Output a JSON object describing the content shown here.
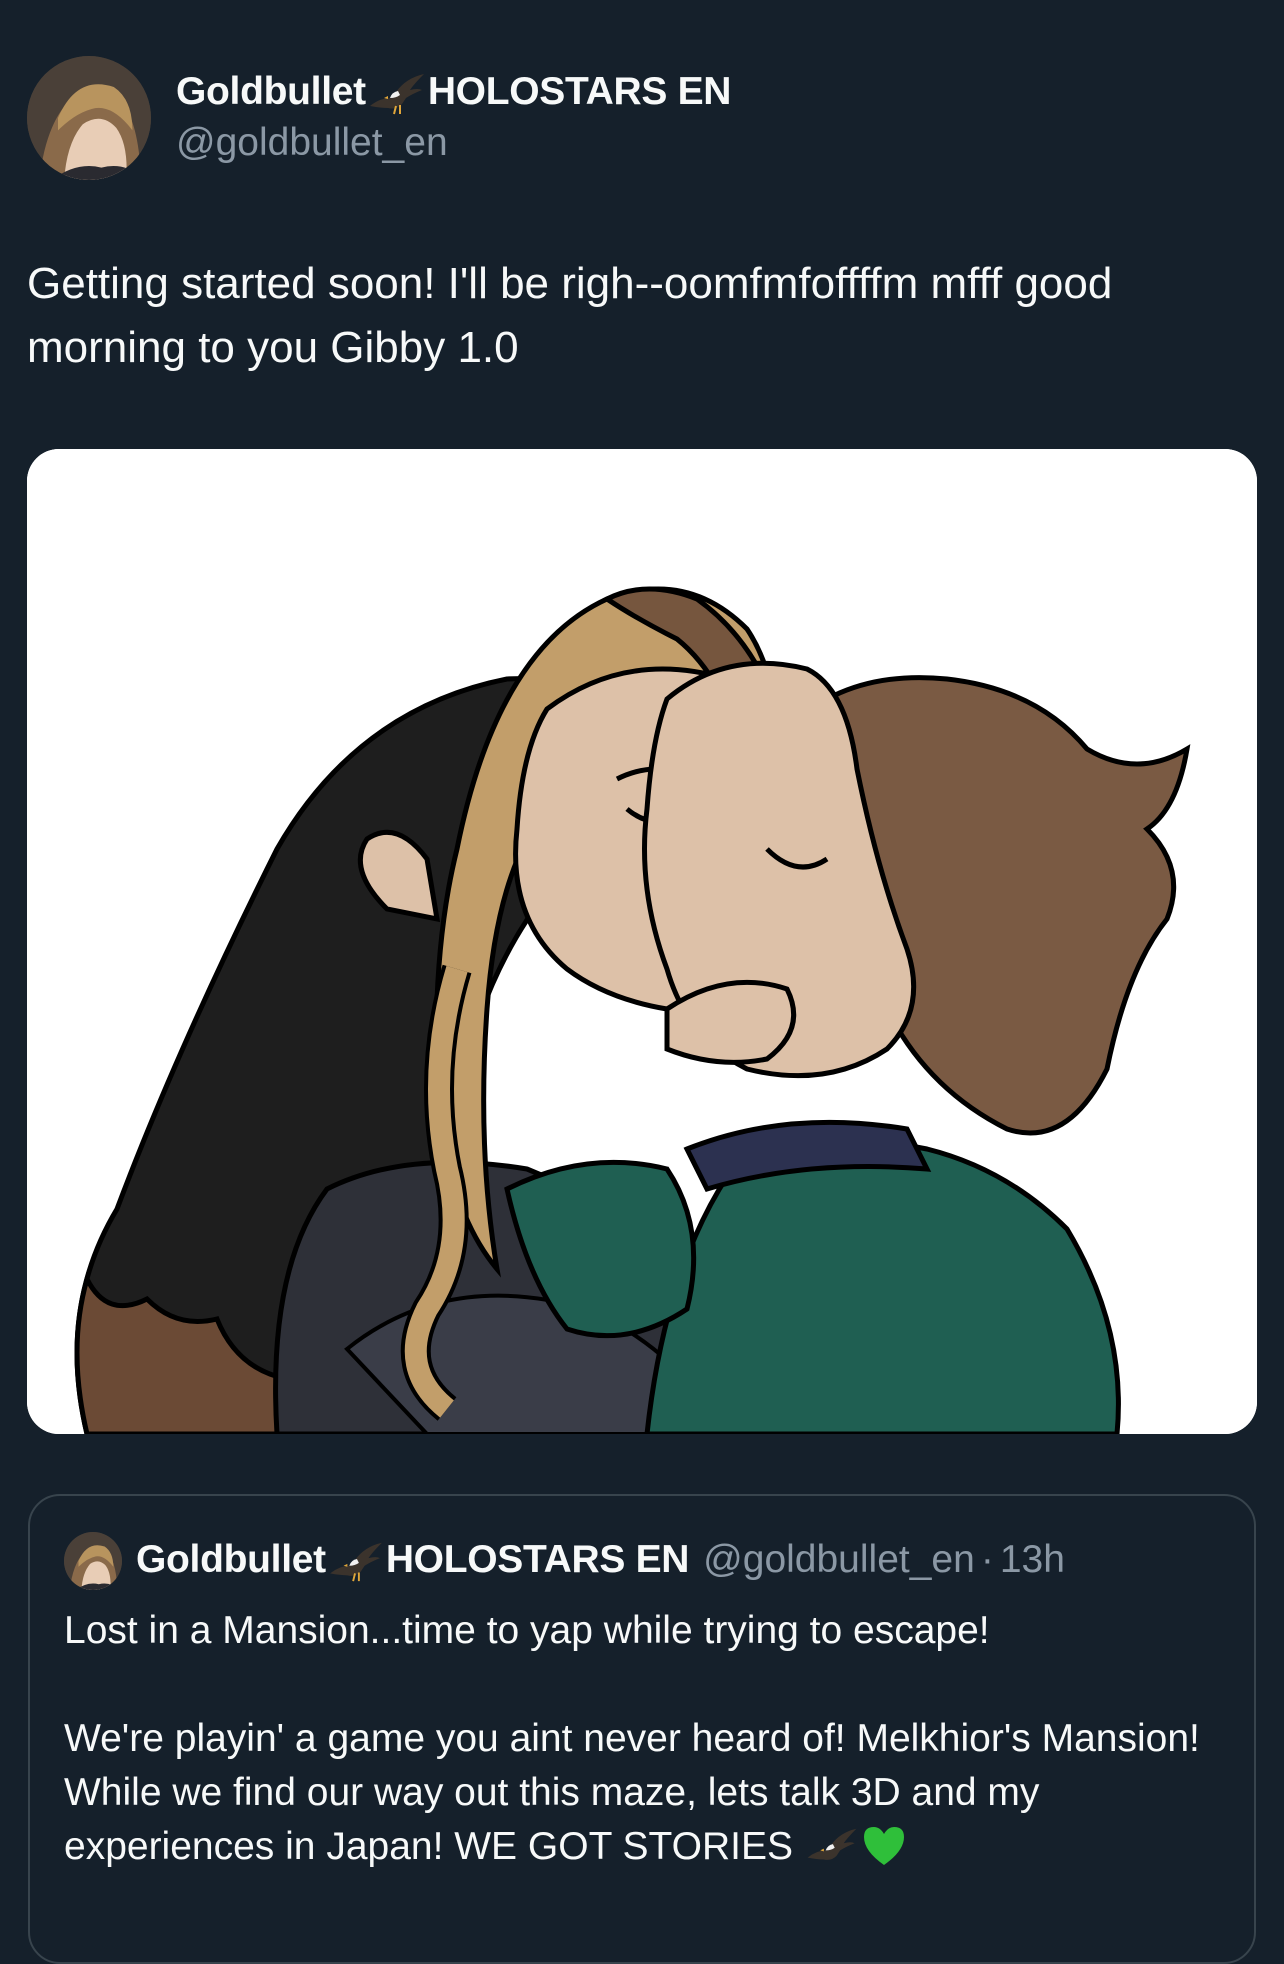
{
  "author": {
    "display_name_prefix": "Goldbullet",
    "display_name_suffix": "HOLOSTARS EN",
    "name_emoji": "eagle-icon",
    "handle": "@goldbullet_en"
  },
  "tweet": {
    "text": "Getting started soon! I'll be righ--oomfmfoffffm mfff good morning to you Gibby 1.0",
    "media": "fan-art-image"
  },
  "quoted_tweet": {
    "display_name_prefix": "Goldbullet",
    "display_name_suffix": "HOLOSTARS EN",
    "handle": "@goldbullet_en",
    "separator": "·",
    "time": "13h",
    "paragraph_1": "Lost in a Mansion...time to yap while trying to escape!",
    "paragraph_2": "We're playin' a game you aint never heard of! Melkhior's Mansion! While we find our way out this maze, lets talk 3D and my experiences in Japan! WE GOT STORIES",
    "trailing_emojis": [
      "eagle-icon",
      "green-heart-icon"
    ]
  },
  "colors": {
    "background": "#15202b",
    "primary_text": "#f7f9f9",
    "secondary_text": "#8b98a5",
    "border": "#38444d",
    "green_heart": "#2fbf3a"
  }
}
